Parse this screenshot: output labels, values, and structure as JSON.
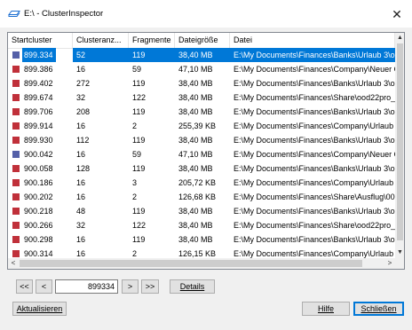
{
  "window": {
    "title": "E:\\ - ClusterInspector",
    "close_glyph": "✕",
    "icon": "drive-icon"
  },
  "table": {
    "columns": [
      "Startcluster",
      "Clusteranz...",
      "Fragmente",
      "Dateigröße",
      "Datei"
    ],
    "rows": [
      {
        "swatch": "#5560a8",
        "start": "899.334",
        "count": "52",
        "frags": "119",
        "size": "38,40 MB",
        "file": "E:\\My Documents\\Finances\\Banks\\Urlaub 3\\ooc",
        "selected": true
      },
      {
        "swatch": "#c0303a",
        "start": "899.386",
        "count": "16",
        "frags": "59",
        "size": "47,10 MB",
        "file": "E:\\My Documents\\Finances\\Company\\Neuer Or"
      },
      {
        "swatch": "#c0303a",
        "start": "899.402",
        "count": "272",
        "frags": "119",
        "size": "38,40 MB",
        "file": "E:\\My Documents\\Finances\\Banks\\Urlaub 3\\ooc"
      },
      {
        "swatch": "#c0303a",
        "start": "899.674",
        "count": "32",
        "frags": "122",
        "size": "38,40 MB",
        "file": "E:\\My Documents\\Finances\\Share\\ood22pro_de"
      },
      {
        "swatch": "#c0303a",
        "start": "899.706",
        "count": "208",
        "frags": "119",
        "size": "38,40 MB",
        "file": "E:\\My Documents\\Finances\\Banks\\Urlaub 3\\ooc"
      },
      {
        "swatch": "#c0303a",
        "start": "899.914",
        "count": "16",
        "frags": "2",
        "size": "255,39 KB",
        "file": "E:\\My Documents\\Finances\\Company\\Urlaub 1\\"
      },
      {
        "swatch": "#c0303a",
        "start": "899.930",
        "count": "112",
        "frags": "119",
        "size": "38,40 MB",
        "file": "E:\\My Documents\\Finances\\Banks\\Urlaub 3\\ooc"
      },
      {
        "swatch": "#5560a8",
        "start": "900.042",
        "count": "16",
        "frags": "59",
        "size": "47,10 MB",
        "file": "E:\\My Documents\\Finances\\Company\\Neuer Or"
      },
      {
        "swatch": "#c0303a",
        "start": "900.058",
        "count": "128",
        "frags": "119",
        "size": "38,40 MB",
        "file": "E:\\My Documents\\Finances\\Banks\\Urlaub 3\\ooc"
      },
      {
        "swatch": "#c0303a",
        "start": "900.186",
        "count": "16",
        "frags": "3",
        "size": "205,72 KB",
        "file": "E:\\My Documents\\Finances\\Company\\Urlaub 3\\"
      },
      {
        "swatch": "#c0303a",
        "start": "900.202",
        "count": "16",
        "frags": "2",
        "size": "126,68 KB",
        "file": "E:\\My Documents\\Finances\\Share\\Ausflug\\003.j"
      },
      {
        "swatch": "#c0303a",
        "start": "900.218",
        "count": "48",
        "frags": "119",
        "size": "38,40 MB",
        "file": "E:\\My Documents\\Finances\\Banks\\Urlaub 3\\ooc"
      },
      {
        "swatch": "#c0303a",
        "start": "900.266",
        "count": "32",
        "frags": "122",
        "size": "38,40 MB",
        "file": "E:\\My Documents\\Finances\\Share\\ood22pro_de"
      },
      {
        "swatch": "#c0303a",
        "start": "900.298",
        "count": "16",
        "frags": "119",
        "size": "38,40 MB",
        "file": "E:\\My Documents\\Finances\\Banks\\Urlaub 3\\ooc"
      },
      {
        "swatch": "#c0303a",
        "start": "900.314",
        "count": "16",
        "frags": "2",
        "size": "126,15 KB",
        "file": "E:\\My Documents\\Finances\\Company\\Urlaub 1\\"
      },
      {
        "swatch": "#c0303a",
        "start": "900.330",
        "count": "64",
        "frags": "119",
        "size": "38,40 MB",
        "file": "E:\\My Documents\\Finances\\Banks\\Urlaub 3\\ooc"
      }
    ]
  },
  "scroll": {
    "up": "▲",
    "down": "▼",
    "left": "<",
    "right": ">"
  },
  "nav": {
    "first": "<<",
    "prev": "<",
    "value": "899334",
    "next": ">",
    "last": ">>",
    "details": "Details"
  },
  "footer": {
    "refresh": "Aktualisieren",
    "help": "Hilfe",
    "close": "Schließen"
  }
}
